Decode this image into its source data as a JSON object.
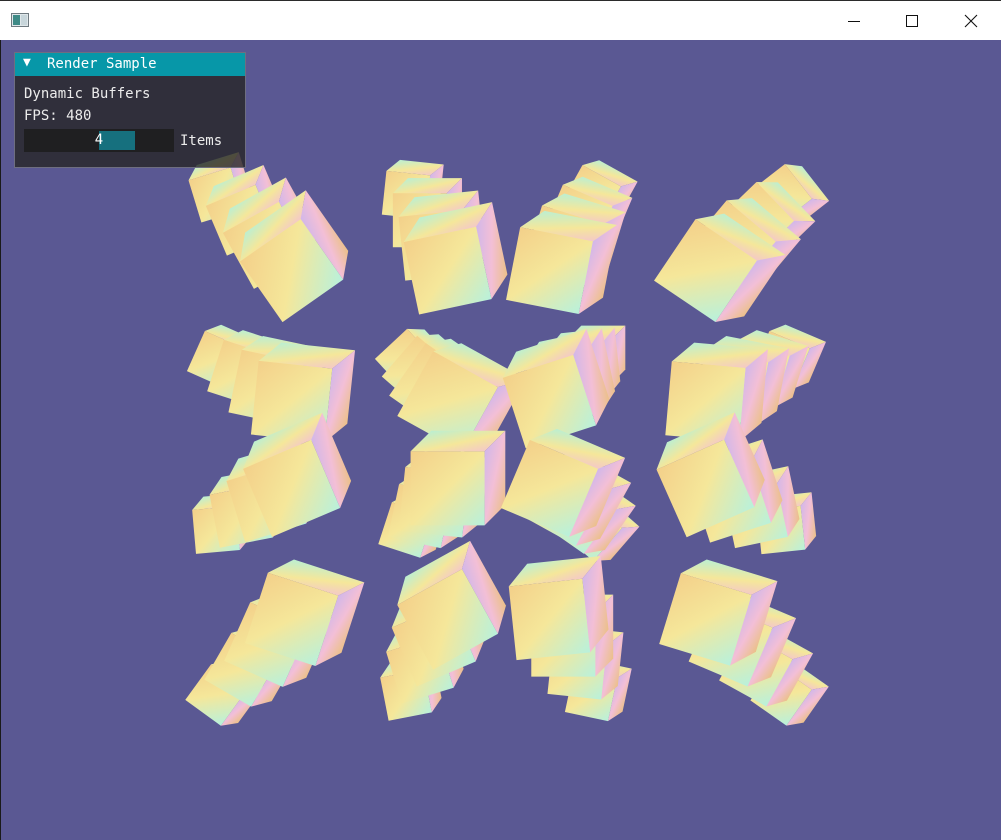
{
  "window": {
    "app_icon": "window-app-icon",
    "controls": [
      "minimize-icon",
      "maximize-icon",
      "close-icon"
    ]
  },
  "scene": {
    "background_color": "#5a5893",
    "cube_colors": [
      "#f5e79a",
      "#aef1df",
      "#f3bfd6",
      "#e9c073",
      "#c8b5ef"
    ],
    "cube_groups": 16
  },
  "panel": {
    "title": "Render Sample",
    "collapse_icon": "triangle-down-icon",
    "header_color": "#0797a8",
    "mode_label": "Dynamic Buffers",
    "fps_label": "FPS: 480",
    "items_slider": {
      "value": "4",
      "label": "Items"
    }
  }
}
